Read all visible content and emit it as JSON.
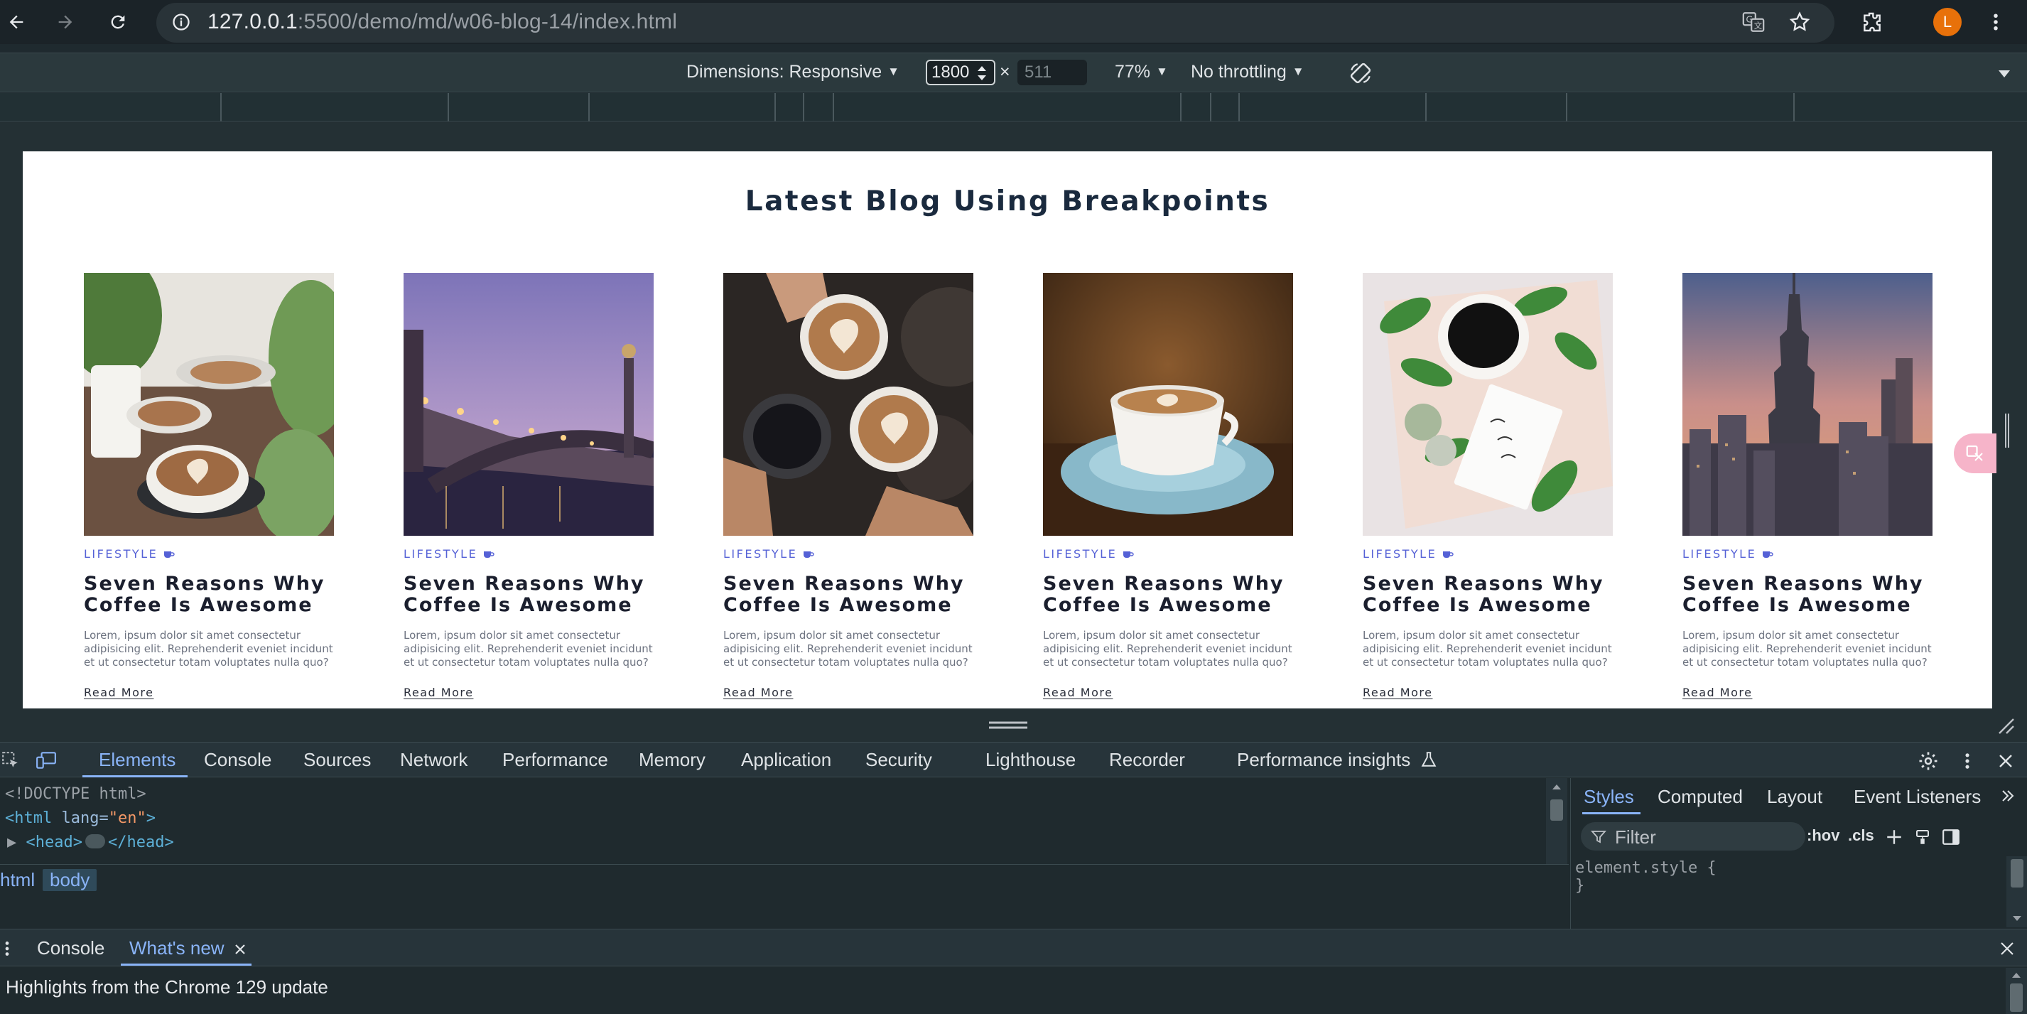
{
  "browser": {
    "url_host": "127.0.0.1",
    "url_path": ":5500/demo/md/w06-blog-14/index.html",
    "avatar_letter": "L"
  },
  "device_toolbar": {
    "dimensions_label": "Dimensions: Responsive",
    "width_value": "1800",
    "height_value": "511",
    "times": "×",
    "zoom": "77%",
    "throttling": "No throttling"
  },
  "page": {
    "title": "Latest Blog Using Breakpoints",
    "cards": [
      {
        "category": "LIFESTYLE",
        "title": "Seven Reasons Why Coffee Is Awesome",
        "text": "Lorem, ipsum dolor sit amet consectetur adipisicing elit. Reprehenderit eveniet incidunt et ut consectetur totam voluptates nulla quo?",
        "link": "Read More"
      },
      {
        "category": "LIFESTYLE",
        "title": "Seven Reasons Why Coffee Is Awesome",
        "text": "Lorem, ipsum dolor sit amet consectetur adipisicing elit. Reprehenderit eveniet incidunt et ut consectetur totam voluptates nulla quo?",
        "link": "Read More"
      },
      {
        "category": "LIFESTYLE",
        "title": "Seven Reasons Why Coffee Is Awesome",
        "text": "Lorem, ipsum dolor sit amet consectetur adipisicing elit. Reprehenderit eveniet incidunt et ut consectetur totam voluptates nulla quo?",
        "link": "Read More"
      },
      {
        "category": "LIFESTYLE",
        "title": "Seven Reasons Why Coffee Is Awesome",
        "text": "Lorem, ipsum dolor sit amet consectetur adipisicing elit. Reprehenderit eveniet incidunt et ut consectetur totam voluptates nulla quo?",
        "link": "Read More"
      },
      {
        "category": "LIFESTYLE",
        "title": "Seven Reasons Why Coffee Is Awesome",
        "text": "Lorem, ipsum dolor sit amet consectetur adipisicing elit. Reprehenderit eveniet incidunt et ut consectetur totam voluptates nulla quo?",
        "link": "Read More"
      },
      {
        "category": "LIFESTYLE",
        "title": "Seven Reasons Why Coffee Is Awesome",
        "text": "Lorem, ipsum dolor sit amet consectetur adipisicing elit. Reprehenderit eveniet incidunt et ut consectetur totam voluptates nulla quo?",
        "link": "Read More"
      }
    ]
  },
  "devtools": {
    "tabs": [
      "Elements",
      "Console",
      "Sources",
      "Network",
      "Performance",
      "Memory",
      "Application",
      "Security",
      "Lighthouse",
      "Recorder",
      "Performance insights"
    ],
    "code": {
      "doctype": "<!DOCTYPE html>",
      "html_open": "<html",
      "html_attr": " lang=",
      "html_attr_val": "\"en\"",
      "html_close": ">",
      "head_open": "<head>",
      "head_close": "</head>"
    },
    "breadcrumbs": [
      "html",
      "body"
    ],
    "styles_tabs": [
      "Styles",
      "Computed",
      "Layout",
      "Event Listeners"
    ],
    "filter_placeholder": "Filter",
    "hov": ":hov",
    "cls": ".cls",
    "element_style_open": "element.style {",
    "element_style_close": "}",
    "drawer_tabs": [
      "Console",
      "What's new"
    ],
    "drawer_message": "Highlights from the Chrome 129 update"
  },
  "colors": {
    "accent": "#8ab4f8",
    "category": "#5561d6",
    "avatar": "#e8710a"
  }
}
